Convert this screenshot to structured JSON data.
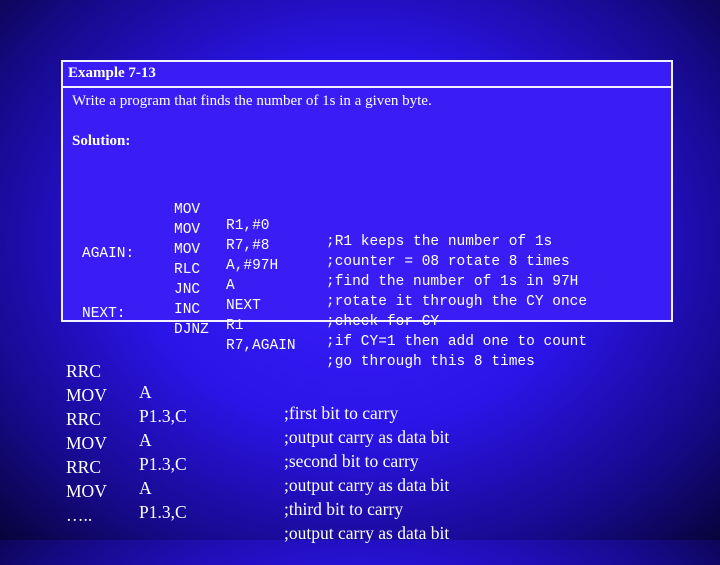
{
  "panel": {
    "header": "Example 7-13",
    "problem": "Write a program that finds the number of 1s in a given byte.",
    "solution_label": "Solution:",
    "code": [
      {
        "label": "",
        "op": "MOV",
        "arg": "R1,#0",
        "comment": ";R1 keeps the number of 1s"
      },
      {
        "label": "",
        "op": "MOV",
        "arg": "R7,#8",
        "comment": ";counter = 08 rotate 8 times"
      },
      {
        "label": "",
        "op": "MOV",
        "arg": "A,#97H",
        "comment": ";find the number of 1s in 97H"
      },
      {
        "label": "AGAIN:",
        "op": "RLC",
        "arg": "A",
        "comment": ";rotate it through the CY once"
      },
      {
        "label": "",
        "op": "JNC",
        "arg": "NEXT",
        "comment": ";check for CY"
      },
      {
        "label": "",
        "op": "INC",
        "arg": "R1",
        "comment": ";if CY=1 then add one to count"
      },
      {
        "label": "NEXT:",
        "op": "DJNZ",
        "arg": "R7,AGAIN",
        "comment": ";go through this 8 times"
      }
    ]
  },
  "bottom_code": [
    {
      "op": "RRC",
      "arg": "A",
      "comment": ";first bit to carry"
    },
    {
      "op": "MOV",
      "arg": "P1.3,C",
      "comment": ";output carry as data bit"
    },
    {
      "op": "RRC",
      "arg": "A",
      "comment": ";second bit to carry"
    },
    {
      "op": "MOV",
      "arg": "P1.3,C",
      "comment": ";output carry as data bit"
    },
    {
      "op": "RRC",
      "arg": "A",
      "comment": ";third bit to carry"
    },
    {
      "op": "MOV",
      "arg": "P1.3,C",
      "comment": ";output carry as data bit"
    },
    {
      "op": "…..",
      "arg": "",
      "comment": ""
    }
  ]
}
